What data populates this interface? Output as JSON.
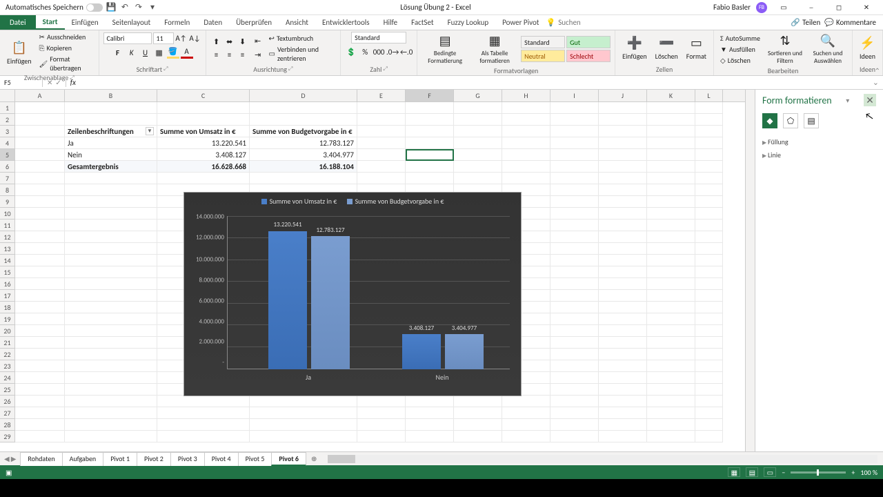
{
  "titlebar": {
    "autosave": "Automatisches Speichern",
    "doc_title": "Lösung Übung 2 - Excel",
    "user": "Fabio Basler",
    "user_initials": "FB"
  },
  "ribbon_tabs": {
    "file": "Datei",
    "tabs": [
      "Start",
      "Einfügen",
      "Seitenlayout",
      "Formeln",
      "Daten",
      "Überprüfen",
      "Ansicht",
      "Entwicklertools",
      "Hilfe",
      "FactSet",
      "Fuzzy Lookup",
      "Power Pivot"
    ],
    "tellme_placeholder": "Suchen",
    "share": "Teilen",
    "comments": "Kommentare"
  },
  "ribbon": {
    "clipboard": {
      "paste": "Einfügen",
      "cut": "Ausschneiden",
      "copy": "Kopieren",
      "format_painter": "Format übertragen",
      "label": "Zwischenablage"
    },
    "font": {
      "name": "Calibri",
      "size": "11",
      "label": "Schriftart"
    },
    "align": {
      "wrap": "Textumbruch",
      "merge": "Verbinden und zentrieren",
      "label": "Ausrichtung"
    },
    "number": {
      "format": "Standard",
      "label": "Zahl"
    },
    "styles": {
      "cond": "Bedingte Formatierung",
      "table": "Als Tabelle formatieren",
      "s1": "Standard",
      "s2": "Gut",
      "s3": "Neutral",
      "s4": "Schlecht",
      "label": "Formatvorlagen"
    },
    "cells": {
      "insert": "Einfügen",
      "delete": "Löschen",
      "format": "Format",
      "label": "Zellen"
    },
    "editing": {
      "sum": "AutoSumme",
      "fill": "Ausfüllen",
      "clear": "Löschen",
      "sort": "Sortieren und Filtern",
      "find": "Suchen und Auswählen",
      "label": "Bearbeiten"
    },
    "ideas": {
      "btn": "Ideen",
      "label": "Ideen"
    }
  },
  "namebox": "F5",
  "columns": [
    "A",
    "B",
    "C",
    "D",
    "E",
    "F",
    "G",
    "H",
    "I",
    "J",
    "K",
    "L"
  ],
  "pivot": {
    "header_rows": "Zeilenbeschriftungen",
    "header_sum1": "Summe von Umsatz in €",
    "header_sum2": "Summe von Budgetvorgabe in €",
    "rows": [
      {
        "label": "Ja",
        "v1": "13.220.541",
        "v2": "12.783.127"
      },
      {
        "label": "Nein",
        "v1": "3.408.127",
        "v2": "3.404.977"
      }
    ],
    "total_label": "Gesamtergebnis",
    "total_v1": "16.628.668",
    "total_v2": "16.188.104"
  },
  "chart_data": {
    "type": "bar",
    "categories": [
      "Ja",
      "Nein"
    ],
    "series": [
      {
        "name": "Summe von Umsatz in €",
        "values": [
          13220541,
          3408127
        ],
        "labels": [
          "13.220.541",
          "3.408.127"
        ],
        "color": "#4a7fc9"
      },
      {
        "name": "Summe von Budgetvorgabe in €",
        "values": [
          12783127,
          3404977
        ],
        "labels": [
          "12.783.127",
          "3.404.977"
        ],
        "color": "#7a9dd0"
      }
    ],
    "y_ticks": [
      "14.000.000",
      "12.000.000",
      "10.000.000",
      "8.000.000",
      "6.000.000",
      "4.000.000",
      "2.000.000",
      "-"
    ],
    "ylim": [
      0,
      14000000
    ]
  },
  "side_pane": {
    "title": "Form formatieren",
    "sec1": "Füllung",
    "sec2": "Linie"
  },
  "sheet_tabs": [
    "Rohdaten",
    "Aufgaben",
    "Pivot 1",
    "Pivot 2",
    "Pivot 3",
    "Pivot 4",
    "Pivot 5",
    "Pivot 6"
  ],
  "active_sheet": "Pivot 6",
  "zoom": "100 %"
}
